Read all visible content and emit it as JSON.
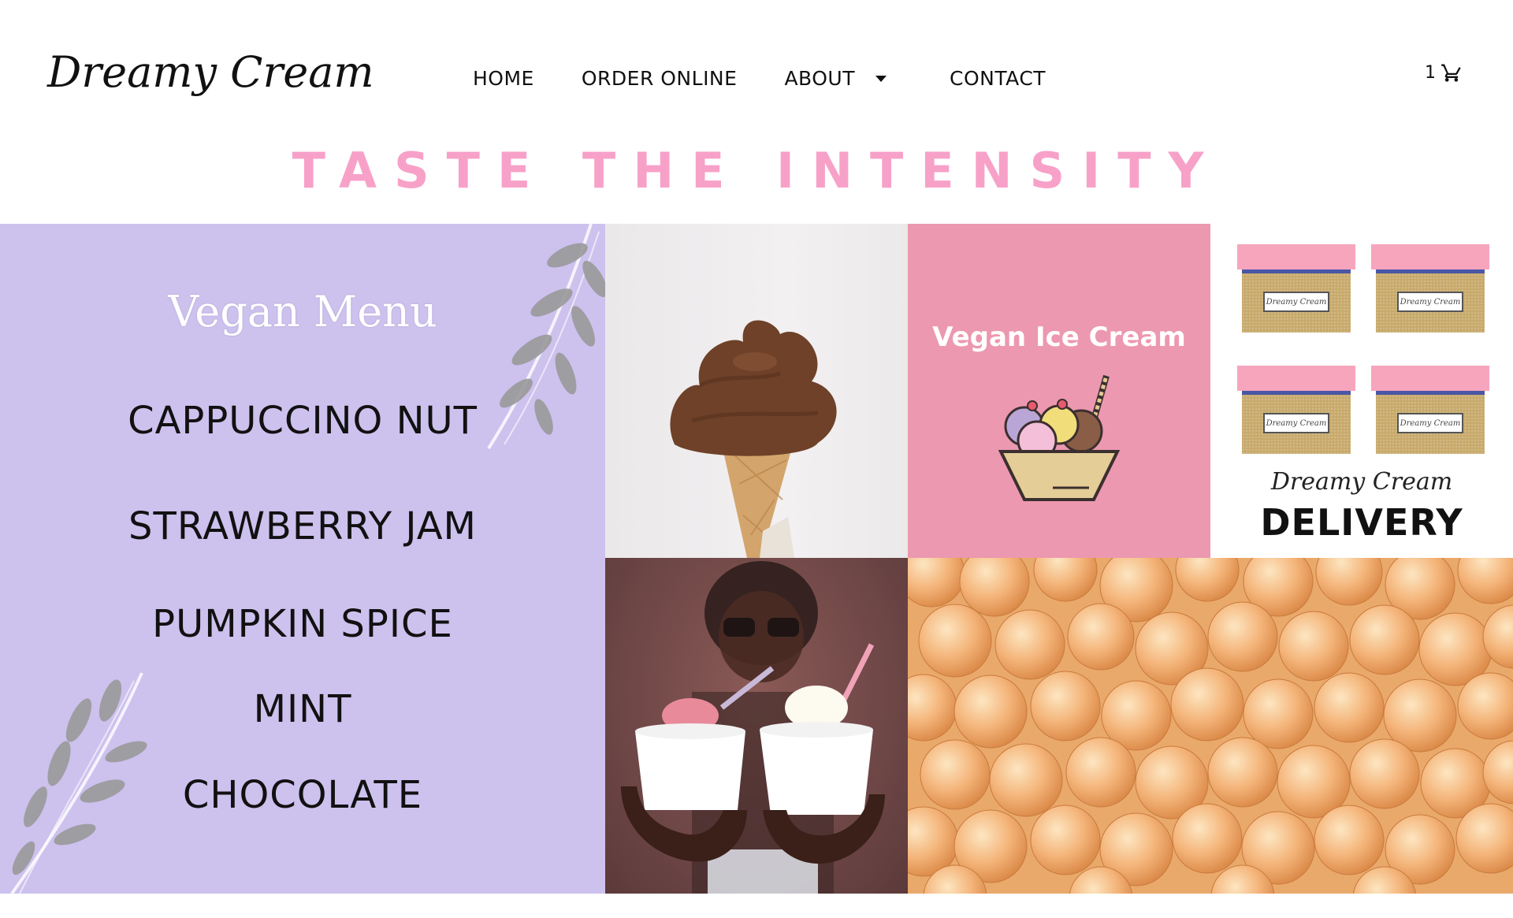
{
  "header": {
    "logo_text": "Dreamy Cream",
    "nav": [
      {
        "label": "HOME"
      },
      {
        "label": "ORDER ONLINE"
      },
      {
        "label": "ABOUT"
      },
      {
        "label": "CONTACT"
      }
    ],
    "cart_count": "1",
    "cart_icon": "cart-icon"
  },
  "tagline": "TASTE THE INTENSITY",
  "menu_tile": {
    "title": "Vegan Menu",
    "items": [
      "CAPPUCCINO NUT",
      "STRAWBERRY JAM",
      "PUMPKIN SPICE",
      "MINT",
      "CHOCOLATE"
    ],
    "background": "#cdc1ee"
  },
  "pink_tile": {
    "title": "Vegan Ice Cream",
    "background": "#ec98b0"
  },
  "delivery_tile": {
    "box_label": "Dreamy Cream",
    "brand": "Dreamy Cream",
    "word": "DELIVERY"
  },
  "colors": {
    "tagline": "#f7a1c9",
    "nav_text": "#111111"
  }
}
